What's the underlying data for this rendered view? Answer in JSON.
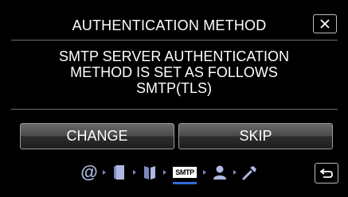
{
  "header": {
    "title": "AUTHENTICATION METHOD",
    "close_icon": "close-icon"
  },
  "message": {
    "lines": [
      "SMTP SERVER AUTHENTICATION",
      "METHOD IS SET AS FOLLOWS",
      "SMTP(TLS)"
    ]
  },
  "actions": {
    "change_label": "CHANGE",
    "skip_label": "SKIP"
  },
  "steps": {
    "items": [
      {
        "icon": "at-sign-icon",
        "text": "@"
      },
      {
        "icon": "book-closed-icon"
      },
      {
        "icon": "book-open-icon"
      },
      {
        "icon": "smtp-icon",
        "text": "SMTP",
        "active": true
      },
      {
        "icon": "person-icon"
      },
      {
        "icon": "wrench-icon"
      }
    ],
    "active_color": "#2f6de0",
    "inactive_color": "#aeb8e0"
  },
  "footer": {
    "back_icon": "return-arrow-icon"
  }
}
